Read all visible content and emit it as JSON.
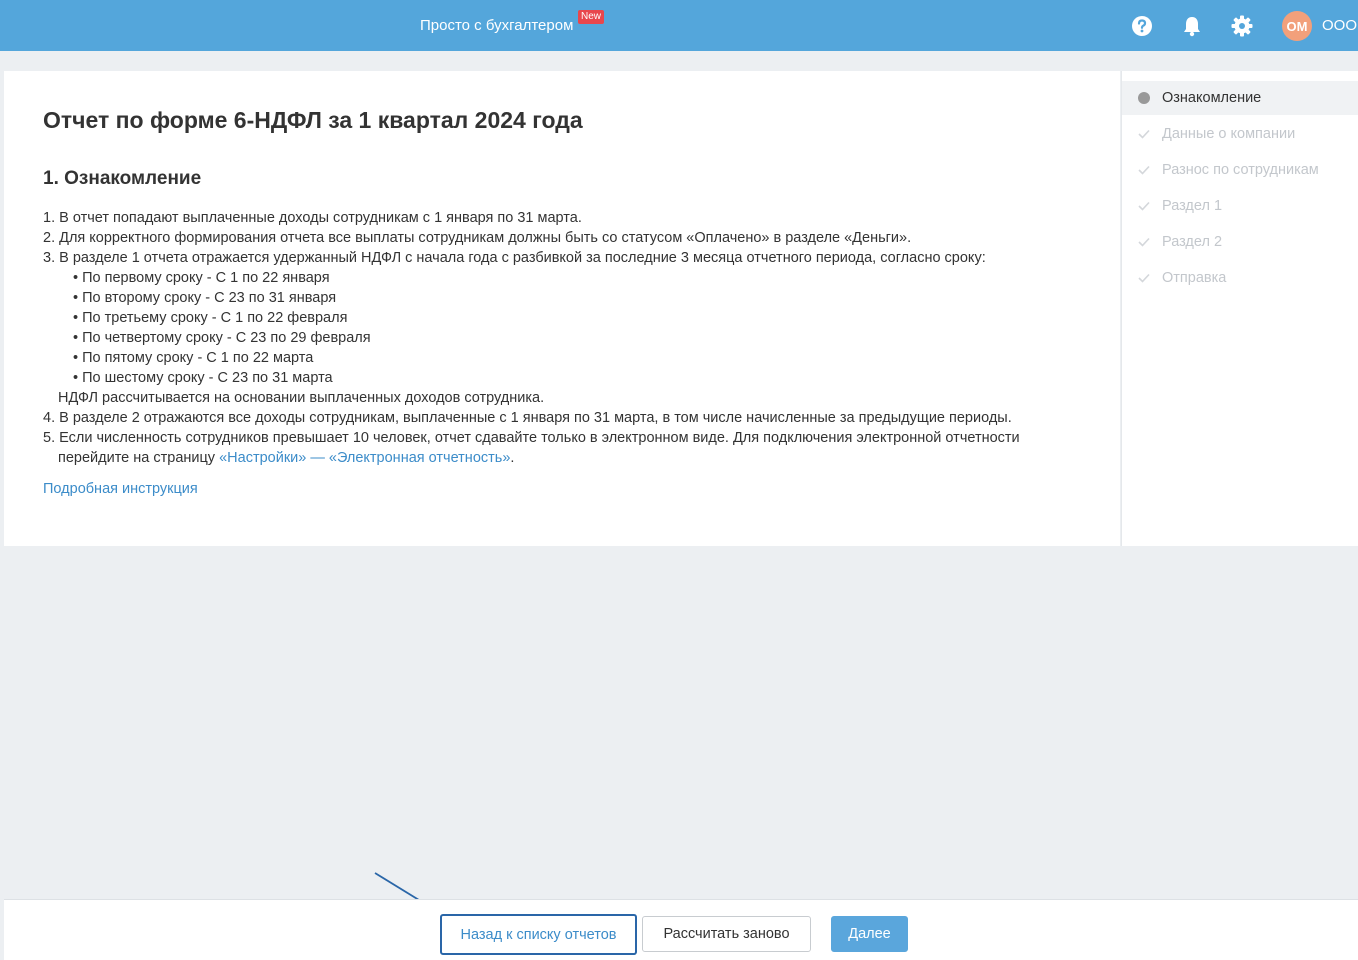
{
  "header": {
    "brand": "Просто с бухгалтером",
    "new_badge": "New",
    "avatar_initials": "ОМ",
    "org_name": "ООО",
    "icons": [
      "help-icon",
      "bell-icon",
      "gear-icon"
    ],
    "accent_color": "#54a6db"
  },
  "main": {
    "title": "Отчет по форме 6-НДФЛ за 1 квартал 2024 года",
    "section_title": "1. Ознакомление",
    "items": {
      "i1": "1. В отчет попадают выплаченные доходы сотрудникам с 1 января по 31 марта.",
      "i2": "2. Для корректного формирования отчета все выплаты сотрудникам должны быть со статусом «Оплачено» в разделе «Деньги».",
      "i3": "3. В разделе 1 отчета отражается удержанный НДФЛ с начала года с разбивкой за последние 3 месяца отчетного периода, согласно сроку:",
      "b1": "• По первому сроку - С 1 по 22 января",
      "b2": "• По второму сроку - С 23 по 31 января",
      "b3": "• По третьему сроку - С 1 по 22 февраля",
      "b4": "• По четвертому сроку - С 23 по 29 февраля",
      "b5": "• По пятому сроку - С 1 по 22 марта",
      "b6": "• По шестому сроку - С 23 по 31 марта",
      "ndfl_note": "НДФЛ рассчитывается на основании выплаченных доходов сотрудника.",
      "i4": "4. В разделе 2 отражаются все доходы сотрудникам, выплаченные с 1 января по 31 марта, в том числе начисленные за предыдущие периоды.",
      "i5": "5. Если численность сотрудников превышает 10 человек, отчет сдавайте только в электронном виде. Для подключения электронной отчетности",
      "i5_cont_prefix": "перейдите на страницу ",
      "i5_link": "«Настройки» — «Электронная отчетность»",
      "i5_suffix": "."
    },
    "instruction_link": "Подробная инструкция"
  },
  "sidebar": {
    "steps": [
      {
        "label": "Ознакомление",
        "state": "active"
      },
      {
        "label": "Данные о компании",
        "state": "pending"
      },
      {
        "label": "Разнос по сотрудникам",
        "state": "pending"
      },
      {
        "label": "Раздел 1",
        "state": "pending"
      },
      {
        "label": "Раздел 2",
        "state": "pending"
      },
      {
        "label": "Отправка",
        "state": "pending"
      }
    ]
  },
  "footer": {
    "back_label": "Назад к списку отчетов",
    "recalc_label": "Рассчитать заново",
    "next_label": "Далее"
  }
}
